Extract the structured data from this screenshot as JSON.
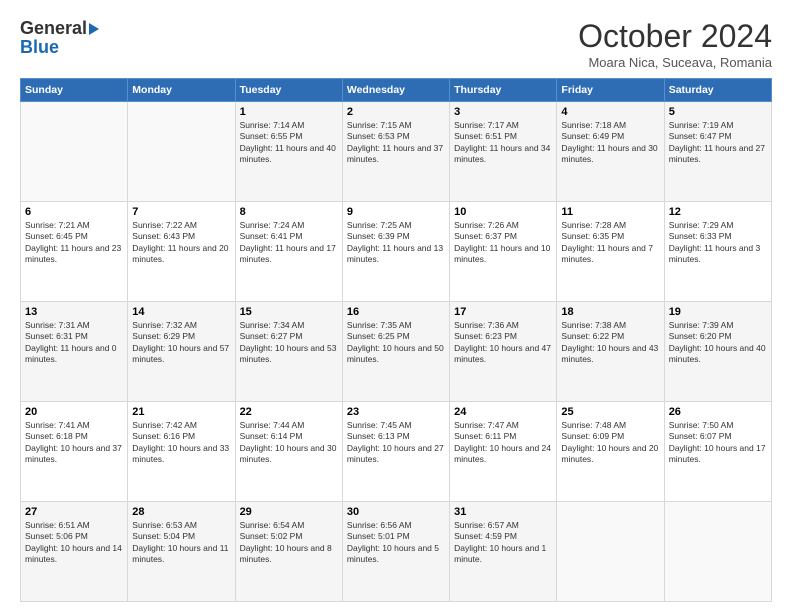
{
  "header": {
    "logo_general": "General",
    "logo_blue": "Blue",
    "month_title": "October 2024",
    "location": "Moara Nica, Suceava, Romania"
  },
  "weekdays": [
    "Sunday",
    "Monday",
    "Tuesday",
    "Wednesday",
    "Thursday",
    "Friday",
    "Saturday"
  ],
  "weeks": [
    [
      {
        "day": "",
        "info": ""
      },
      {
        "day": "",
        "info": ""
      },
      {
        "day": "1",
        "info": "Sunrise: 7:14 AM\nSunset: 6:55 PM\nDaylight: 11 hours and 40 minutes."
      },
      {
        "day": "2",
        "info": "Sunrise: 7:15 AM\nSunset: 6:53 PM\nDaylight: 11 hours and 37 minutes."
      },
      {
        "day": "3",
        "info": "Sunrise: 7:17 AM\nSunset: 6:51 PM\nDaylight: 11 hours and 34 minutes."
      },
      {
        "day": "4",
        "info": "Sunrise: 7:18 AM\nSunset: 6:49 PM\nDaylight: 11 hours and 30 minutes."
      },
      {
        "day": "5",
        "info": "Sunrise: 7:19 AM\nSunset: 6:47 PM\nDaylight: 11 hours and 27 minutes."
      }
    ],
    [
      {
        "day": "6",
        "info": "Sunrise: 7:21 AM\nSunset: 6:45 PM\nDaylight: 11 hours and 23 minutes."
      },
      {
        "day": "7",
        "info": "Sunrise: 7:22 AM\nSunset: 6:43 PM\nDaylight: 11 hours and 20 minutes."
      },
      {
        "day": "8",
        "info": "Sunrise: 7:24 AM\nSunset: 6:41 PM\nDaylight: 11 hours and 17 minutes."
      },
      {
        "day": "9",
        "info": "Sunrise: 7:25 AM\nSunset: 6:39 PM\nDaylight: 11 hours and 13 minutes."
      },
      {
        "day": "10",
        "info": "Sunrise: 7:26 AM\nSunset: 6:37 PM\nDaylight: 11 hours and 10 minutes."
      },
      {
        "day": "11",
        "info": "Sunrise: 7:28 AM\nSunset: 6:35 PM\nDaylight: 11 hours and 7 minutes."
      },
      {
        "day": "12",
        "info": "Sunrise: 7:29 AM\nSunset: 6:33 PM\nDaylight: 11 hours and 3 minutes."
      }
    ],
    [
      {
        "day": "13",
        "info": "Sunrise: 7:31 AM\nSunset: 6:31 PM\nDaylight: 11 hours and 0 minutes."
      },
      {
        "day": "14",
        "info": "Sunrise: 7:32 AM\nSunset: 6:29 PM\nDaylight: 10 hours and 57 minutes."
      },
      {
        "day": "15",
        "info": "Sunrise: 7:34 AM\nSunset: 6:27 PM\nDaylight: 10 hours and 53 minutes."
      },
      {
        "day": "16",
        "info": "Sunrise: 7:35 AM\nSunset: 6:25 PM\nDaylight: 10 hours and 50 minutes."
      },
      {
        "day": "17",
        "info": "Sunrise: 7:36 AM\nSunset: 6:23 PM\nDaylight: 10 hours and 47 minutes."
      },
      {
        "day": "18",
        "info": "Sunrise: 7:38 AM\nSunset: 6:22 PM\nDaylight: 10 hours and 43 minutes."
      },
      {
        "day": "19",
        "info": "Sunrise: 7:39 AM\nSunset: 6:20 PM\nDaylight: 10 hours and 40 minutes."
      }
    ],
    [
      {
        "day": "20",
        "info": "Sunrise: 7:41 AM\nSunset: 6:18 PM\nDaylight: 10 hours and 37 minutes."
      },
      {
        "day": "21",
        "info": "Sunrise: 7:42 AM\nSunset: 6:16 PM\nDaylight: 10 hours and 33 minutes."
      },
      {
        "day": "22",
        "info": "Sunrise: 7:44 AM\nSunset: 6:14 PM\nDaylight: 10 hours and 30 minutes."
      },
      {
        "day": "23",
        "info": "Sunrise: 7:45 AM\nSunset: 6:13 PM\nDaylight: 10 hours and 27 minutes."
      },
      {
        "day": "24",
        "info": "Sunrise: 7:47 AM\nSunset: 6:11 PM\nDaylight: 10 hours and 24 minutes."
      },
      {
        "day": "25",
        "info": "Sunrise: 7:48 AM\nSunset: 6:09 PM\nDaylight: 10 hours and 20 minutes."
      },
      {
        "day": "26",
        "info": "Sunrise: 7:50 AM\nSunset: 6:07 PM\nDaylight: 10 hours and 17 minutes."
      }
    ],
    [
      {
        "day": "27",
        "info": "Sunrise: 6:51 AM\nSunset: 5:06 PM\nDaylight: 10 hours and 14 minutes."
      },
      {
        "day": "28",
        "info": "Sunrise: 6:53 AM\nSunset: 5:04 PM\nDaylight: 10 hours and 11 minutes."
      },
      {
        "day": "29",
        "info": "Sunrise: 6:54 AM\nSunset: 5:02 PM\nDaylight: 10 hours and 8 minutes."
      },
      {
        "day": "30",
        "info": "Sunrise: 6:56 AM\nSunset: 5:01 PM\nDaylight: 10 hours and 5 minutes."
      },
      {
        "day": "31",
        "info": "Sunrise: 6:57 AM\nSunset: 4:59 PM\nDaylight: 10 hours and 1 minute."
      },
      {
        "day": "",
        "info": ""
      },
      {
        "day": "",
        "info": ""
      }
    ]
  ]
}
